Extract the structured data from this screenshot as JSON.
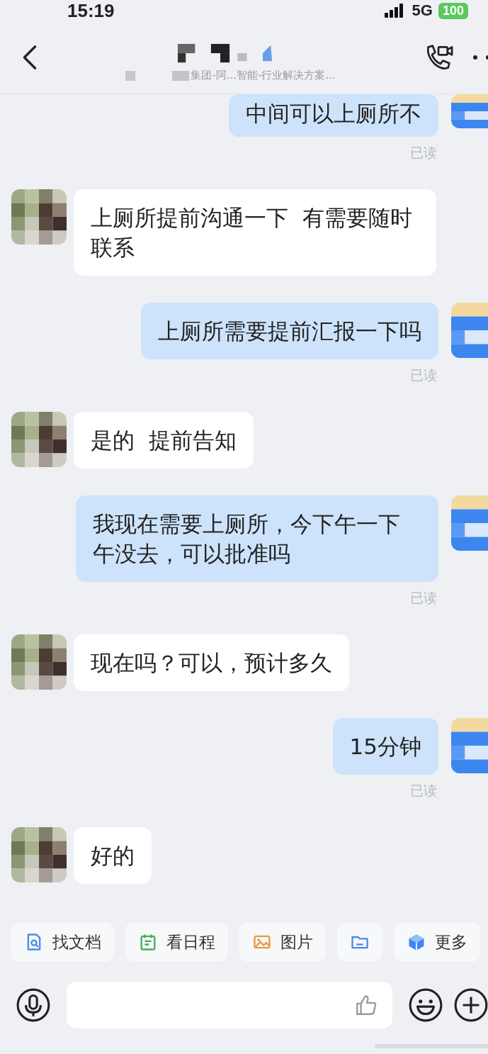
{
  "status_bar": {
    "time": "15:19",
    "network": "5G",
    "battery": "100"
  },
  "header": {
    "subtitle": "集团-阿...智能-行业解决方案..."
  },
  "messages": [
    {
      "kind": "outgoing",
      "text": "中间可以上厕所不",
      "read_label": "已读"
    },
    {
      "kind": "incoming",
      "text": "上厕所提前沟通一下  有需要随时联系"
    },
    {
      "kind": "outgoing",
      "text": "上厕所需要提前汇报一下吗",
      "read_label": "已读"
    },
    {
      "kind": "incoming",
      "text": "是的  提前告知"
    },
    {
      "kind": "outgoing",
      "text": "我现在需要上厕所，今下午一下午没去，可以批准吗",
      "read_label": "已读"
    },
    {
      "kind": "incoming",
      "text": "现在吗？可以，预计多久"
    },
    {
      "kind": "outgoing",
      "text": "15分钟",
      "read_label": "已读"
    },
    {
      "kind": "incoming",
      "text": "好的"
    }
  ],
  "quick_actions": [
    {
      "kind": "doc",
      "label": "找文档"
    },
    {
      "kind": "calendar",
      "label": "看日程"
    },
    {
      "kind": "image",
      "label": "图片"
    },
    {
      "kind": "folder"
    },
    {
      "kind": "more",
      "label": "更多"
    }
  ]
}
